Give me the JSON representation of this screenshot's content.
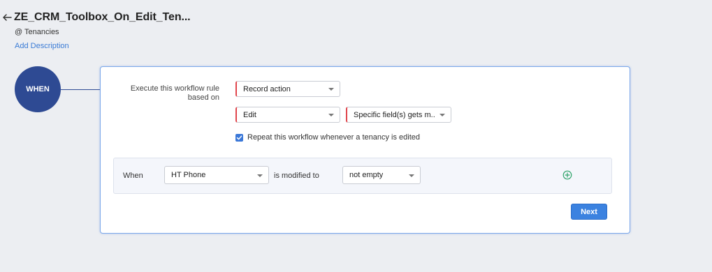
{
  "header": {
    "title": "ZE_CRM_Toolbox_On_Edit_Ten...",
    "module": "@ Tenancies",
    "add_description": "Add Description"
  },
  "when_node": {
    "label": "WHEN"
  },
  "rule": {
    "label": "Execute this workflow rule based on",
    "trigger_select": "Record action",
    "action_select": "Edit",
    "field_condition_select": "Specific field(s) gets m...",
    "repeat_checkbox": {
      "checked": true,
      "label": "Repeat this workflow whenever a tenancy is edited"
    }
  },
  "condition": {
    "when_label": "When",
    "field_select": "HT Phone",
    "modified_label": "is modified to",
    "value_select": "not empty"
  },
  "next_button": "Next",
  "icons": {
    "back": "back-arrow-icon",
    "add": "add-circle-icon",
    "check": "check-icon"
  },
  "colors": {
    "accent": "#3b82e0",
    "when_circle": "#2e4a93",
    "required": "#e0454c",
    "add_icon": "#2fa46a",
    "link": "#3a7bd5"
  }
}
